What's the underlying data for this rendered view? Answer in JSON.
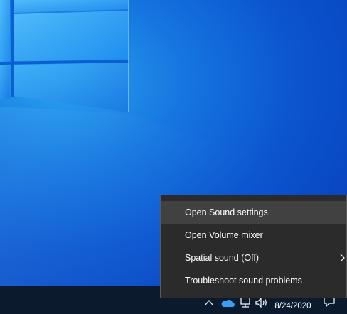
{
  "context_menu": {
    "items": [
      {
        "label": "Open Sound settings"
      },
      {
        "label": "Open Volume mixer"
      },
      {
        "label": "Spatial sound (Off)"
      },
      {
        "label": "Troubleshoot sound problems"
      }
    ]
  },
  "taskbar": {
    "date": "8/24/2020",
    "icons": [
      "chevron-up-icon",
      "onedrive-icon",
      "network-icon",
      "volume-icon",
      "notification-icon"
    ]
  },
  "colors": {
    "menu_bg": "#2b2b2b",
    "menu_hover": "#414141",
    "taskbar_bg": "#0c1a2e",
    "desktop_accent": "#1676e0"
  }
}
